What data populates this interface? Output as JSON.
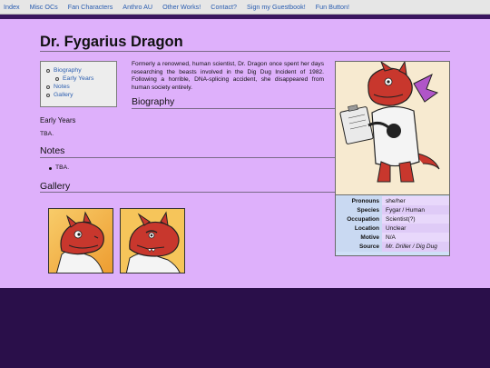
{
  "nav": {
    "links": [
      "Index",
      "Misc OCs",
      "Fan Characters",
      "Anthro AU",
      "Other Works!",
      "Contact?",
      "Sign my Guestbook!",
      "Fun Button!"
    ]
  },
  "page": {
    "title": "Dr. Fygarius Dragon",
    "toc": [
      {
        "label": "Biography",
        "level": 1
      },
      {
        "label": "Early Years",
        "level": 2
      },
      {
        "label": "Notes",
        "level": 1
      },
      {
        "label": "Gallery",
        "level": 1
      }
    ],
    "intro": "Formerly a renowned, human scientist, Dr. Dragon once spent her days researching the beasts involved in the Dig Dug Incident of 1982. Following a horrible, DNA-splicing accident, she disappeared from human society entirely.",
    "biography": {
      "heading": "Biography",
      "early_years_heading": "Early Years",
      "early_years_text": "TBA."
    },
    "notes": {
      "heading": "Notes",
      "items": [
        "TBA."
      ]
    },
    "gallery": {
      "heading": "Gallery",
      "thumb_count": 2
    },
    "infobox": {
      "rows": [
        {
          "key": "Pronouns",
          "value": "she/her"
        },
        {
          "key": "Species",
          "value": "Fygar / Human"
        },
        {
          "key": "Occupation",
          "value": "Scientist(?)"
        },
        {
          "key": "Location",
          "value": "Unclear"
        },
        {
          "key": "Motive",
          "value": "N/A"
        },
        {
          "key": "Source",
          "value": "Mr. Driller / Dig Dug"
        }
      ]
    }
  },
  "colors": {
    "page_bg": "#deb0fb",
    "footer_bg": "#2a0f4a",
    "link": "#2a5db0",
    "dragon_red": "#c8372d",
    "coat_white": "#f4f4f4"
  }
}
